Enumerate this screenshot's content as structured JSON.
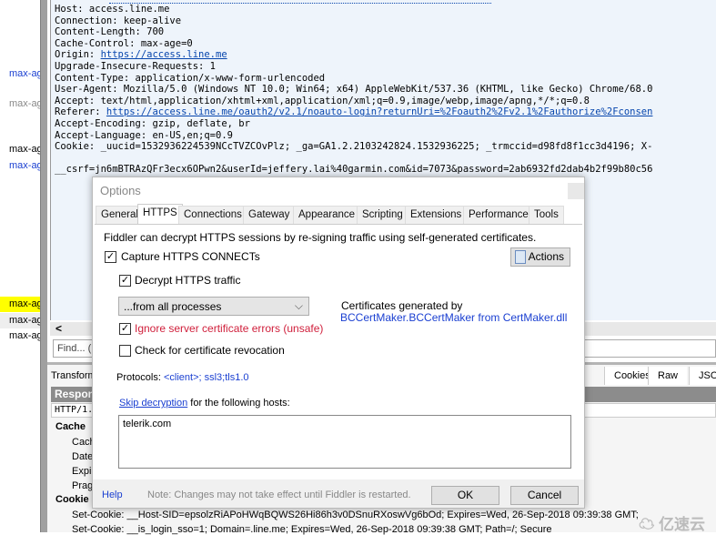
{
  "session_list": {
    "rows": [
      {
        "text": "max-ag",
        "color": "#1a3fd1"
      },
      {
        "text": "max-ag",
        "color": "#888888"
      },
      {
        "text": "max-ag",
        "color": "#000000"
      },
      {
        "text": "max-ag",
        "color": "#1a3fd1"
      },
      {
        "text": "max-ag",
        "color": "#000000",
        "highlight": "#ffff00"
      },
      {
        "text": "max-ag",
        "color": "#000000"
      },
      {
        "text": "max-ag",
        "color": "#000000"
      }
    ]
  },
  "request": {
    "lines": [
      "Host: access.line.me",
      "Connection: keep-alive",
      "Content-Length: 700",
      "Cache-Control: max-age=0"
    ],
    "origin_label": "Origin: ",
    "origin_url": "https://access.line.me",
    "lines2": [
      "Upgrade-Insecure-Requests: 1",
      "Content-Type: application/x-www-form-urlencoded",
      "User-Agent: Mozilla/5.0 (Windows NT 10.0; Win64; x64) AppleWebKit/537.36 (KHTML, like Gecko) Chrome/68.0",
      "Accept: text/html,application/xhtml+xml,application/xml;q=0.9,image/webp,image/apng,*/*;q=0.8"
    ],
    "referer_label": "Referer: ",
    "referer_url": "https://access.line.me/oauth2/v2.1/noauto-login?returnUri=%2Foauth2%2Fv2.1%2Fauthorize%2Fconsen",
    "lines3": [
      "Accept-Encoding: gzip, deflate, br",
      "Accept-Language: en-US,en;q=0.9",
      "Cookie: _uucid=1532936224539NCcTVZCOvPlz; _ga=GA1.2.2103242824.1532936225; _trmccid=d98fd8f1cc3d4196; X-"
    ],
    "body": "__csrf=jn6mBTRAzQFr3ecx6OPwn2&userId=jeffery.lai%40garmin.com&id=7073&password=2ab6932fd2dab4b2f99b80c56"
  },
  "find_placeholder": "Find... (",
  "scroll_left": "<",
  "response": {
    "tabs": [
      "Transform",
      "Cookies",
      "Raw",
      "JSO"
    ],
    "header": "Respon",
    "status_line": "HTTP/1.",
    "tree": [
      "Cache",
      "Cach",
      "Date",
      "Expi",
      "Prag",
      "Cookie"
    ],
    "set_cookie": [
      {
        "key": "Set-Cookie:",
        "value": "__Host-SID=epsolzRiAPoHWqBQWS26Hi86h3v0DSnuRXoswVg6bOd; Expires=Wed, 26-Sep-2018 09:39:38 GMT;"
      },
      {
        "key": "Set-Cookie:",
        "value": "__is_login_sso=1; Domain=.line.me; Expires=Wed, 26-Sep-2018 09:39:38 GMT; Path=/; Secure"
      }
    ]
  },
  "dialog": {
    "title": "Options",
    "tabs": [
      "General",
      "HTTPS",
      "Connections",
      "Gateway",
      "Appearance",
      "Scripting",
      "Extensions",
      "Performance",
      "Tools"
    ],
    "active_tab": "HTTPS",
    "intro": "Fiddler can decrypt HTTPS sessions by re-signing traffic using self-generated certificates.",
    "capture_label": "Capture HTTPS CONNECTs",
    "capture_checked": true,
    "decrypt_label": "Decrypt HTTPS traffic",
    "decrypt_checked": true,
    "process_select": "...from all processes",
    "ignore_label": "Ignore server certificate errors (unsafe)",
    "ignore_checked": true,
    "revocation_label": "Check for certificate revocation",
    "revocation_checked": false,
    "actions_label": "Actions",
    "cert_label": "Certificates generated by",
    "cert_link": "BCCertMaker.BCCertMaker from CertMaker.dll",
    "protocols_label": "Protocols: ",
    "protocols_value": "<client>; ssl3;tls1.0",
    "skip_link": "Skip decryption",
    "skip_rest": " for the following hosts:",
    "hosts": "telerik.com",
    "help": "Help",
    "note": "Note: Changes may not take effect until Fiddler is restarted.",
    "ok": "OK",
    "cancel": "Cancel"
  },
  "watermark": "亿速云",
  "colors": {
    "link": "#1a3fd1",
    "warning": "#d0203c",
    "highlight": "#ffff00"
  }
}
